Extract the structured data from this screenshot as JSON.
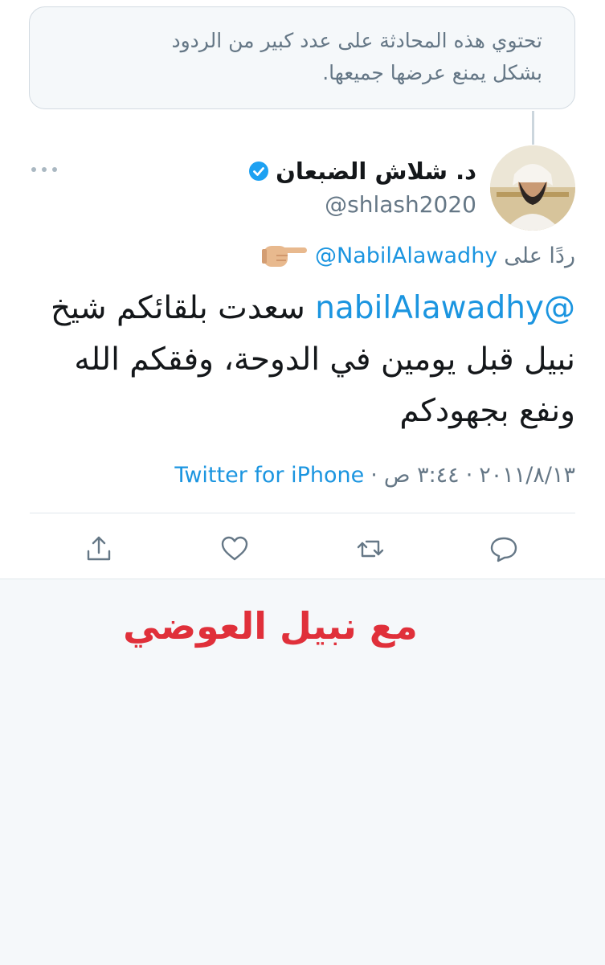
{
  "notice": {
    "line1": "تحتوي هذه المحادثة على عدد كبير من الردود",
    "line2": "بشكل يمنع عرضها جميعها."
  },
  "author": {
    "display_name": "د. شلاش الضبعان",
    "handle": "@shlash2020",
    "verified": true,
    "avatar_icon": "profile-photo"
  },
  "reply": {
    "prefix": "ردًا على",
    "to": "@NabilAlawadhy",
    "emoji": "pointing-right-hand"
  },
  "tweet": {
    "mention": "@nabilAlawadhy",
    "line1_rest": " سعدت بلقائكم شيخ",
    "line2": "نبيل قبل يومين في الدوحة، وفقكم الله",
    "line3": "ونفع بجهودكم"
  },
  "meta": {
    "date": "٢٠١١/٨/١٣",
    "sep1": "·",
    "time": "٣:٤٤ ص",
    "sep2": "·",
    "source": "Twitter for iPhone"
  },
  "actions": {
    "reply_icon": "comment-icon",
    "retweet_icon": "retweet-icon",
    "like_icon": "heart-icon",
    "share_icon": "share-icon"
  },
  "caption": "مع نبيل العوضي",
  "colors": {
    "link": "#1b95e0",
    "muted": "#657786",
    "caption": "#e0303a",
    "verified": "#1da1f2"
  }
}
